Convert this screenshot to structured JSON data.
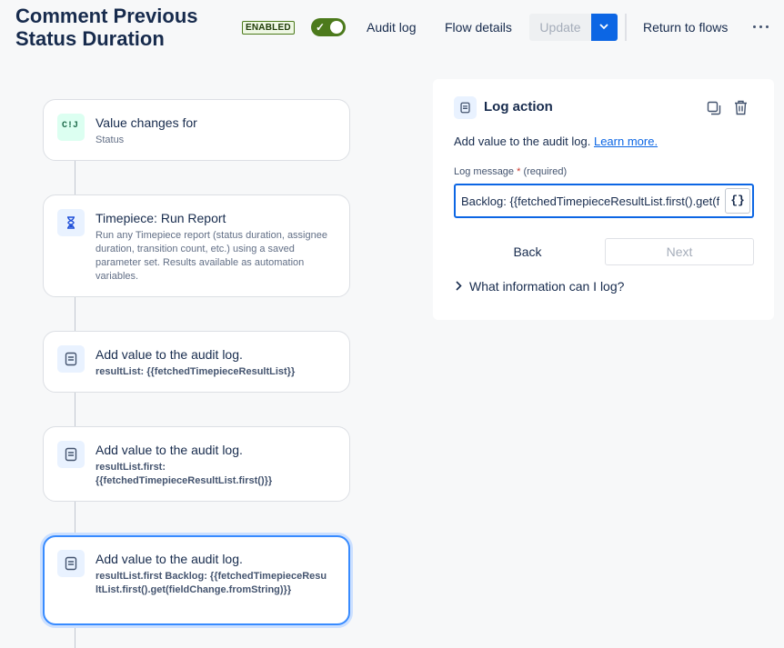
{
  "header": {
    "title": "Comment Previous Status Duration",
    "status_badge": "ENABLED",
    "audit_log": "Audit log",
    "flow_details": "Flow details",
    "update": "Update",
    "return_to_flows": "Return to flows"
  },
  "flow": {
    "steps": [
      {
        "title": "Value changes for",
        "subtitle": "Status",
        "icon": "value-change-icon",
        "icon_text": "C!J"
      },
      {
        "title": "Timepiece: Run Report",
        "subtitle": "Run any Timepiece report (status duration, assignee duration, transition count, etc.) using a saved parameter set. Results available as automation variables.",
        "icon": "hourglass-icon"
      },
      {
        "title": "Add value to the audit log.",
        "subtitle": "resultList: {{fetchedTimepieceResultList}}",
        "icon": "log-icon"
      },
      {
        "title": "Add value to the audit log.",
        "subtitle": "resultList.first: {{fetchedTimepieceResultList.first()}}",
        "icon": "log-icon"
      },
      {
        "title": "Add value to the audit log.",
        "subtitle": "resultList.first Backlog: {{fetchedTimepieceResultList.first().get(fieldChange.fromString)}}",
        "icon": "log-icon"
      }
    ]
  },
  "panel": {
    "title": "Log action",
    "description": "Add value to the audit log.",
    "learn_more": "Learn more.",
    "log_message_label": "Log message",
    "required_marker": "*",
    "required_text": "(required)",
    "log_message_value": "Backlog: {{fetchedTimepieceResultList.first().get(fieldChange.fromString)}}",
    "brace_button": "{}",
    "back": "Back",
    "next": "Next",
    "expander": "What information can I log?"
  },
  "colors": {
    "accent": "#0c66e4",
    "enabled": "#4c7a1c",
    "selected_border": "#388bff"
  }
}
